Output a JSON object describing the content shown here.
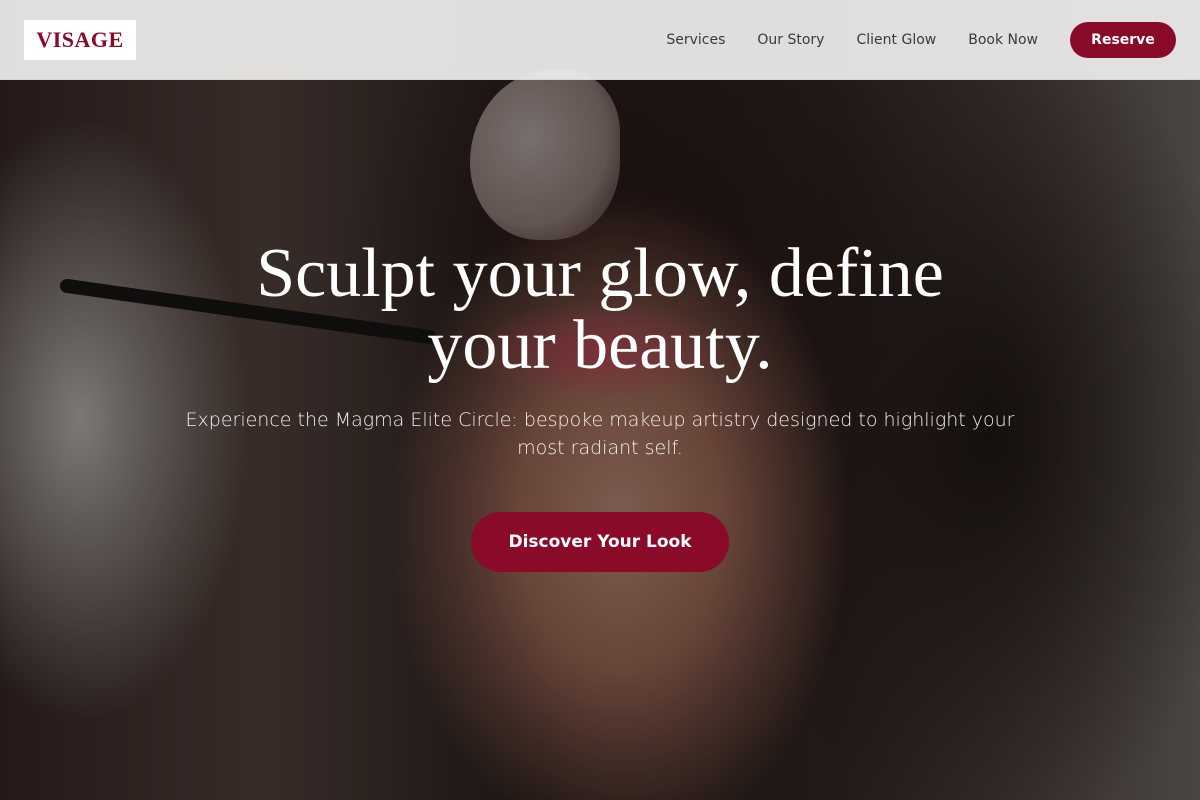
{
  "header": {
    "logo_text": "VISAGE",
    "nav": [
      {
        "label": "Services"
      },
      {
        "label": "Our Story"
      },
      {
        "label": "Client Glow"
      },
      {
        "label": "Book Now"
      }
    ],
    "cta_label": "Reserve"
  },
  "hero": {
    "headline": "Sculpt your glow, define your beauty.",
    "subheadline": "Experience the Magma Elite Circle: bespoke makeup artistry designed to highlight your most radiant self.",
    "cta_label": "Discover Your Look"
  },
  "colors": {
    "brand": "#8a0a29",
    "header_bg": "#eeeeee",
    "text_light": "#ffffff"
  }
}
